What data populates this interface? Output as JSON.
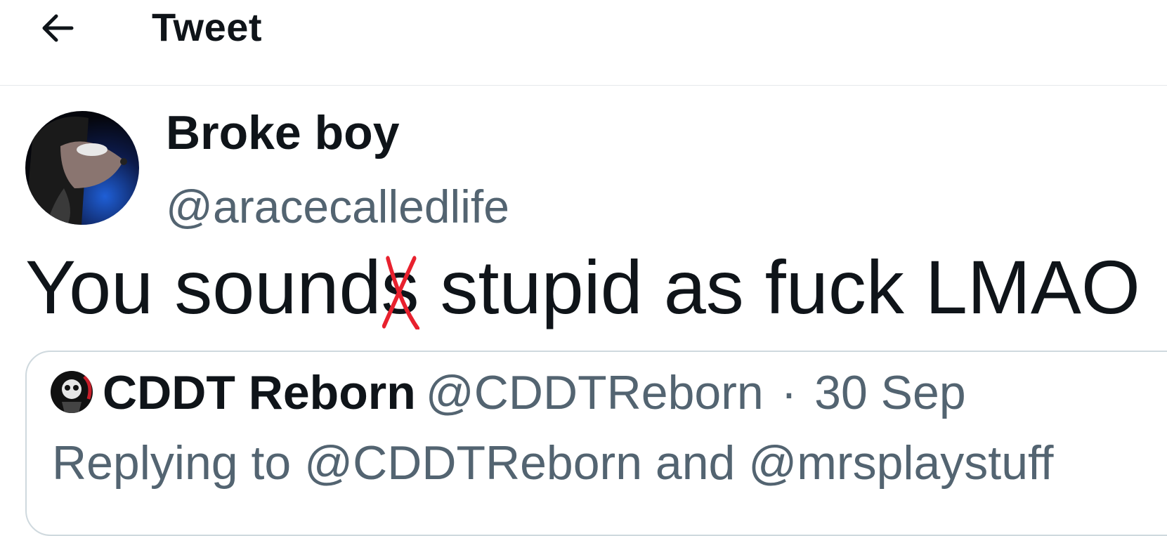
{
  "header": {
    "back_icon": "arrow-left-icon",
    "title": "Tweet"
  },
  "tweet": {
    "author_name": "Broke boy",
    "author_handle": "@aracecalledlife",
    "avatar_icon": "profile-avatar",
    "text_part1": "You sound",
    "struck_letter": "s",
    "text_part2": " stupid as fuck LMAO",
    "strike_color": "#e8212e"
  },
  "quoted_tweet": {
    "author_name": "CDDT Reborn",
    "author_handle": "@CDDTReborn",
    "separator": "·",
    "date": "30 Sep",
    "replying_to": "Replying to @CDDTReborn and @mrsplaystuff"
  }
}
